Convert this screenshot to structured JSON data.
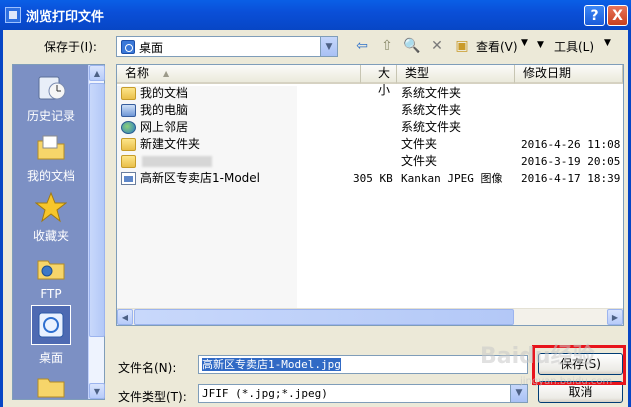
{
  "window": {
    "title": "浏览打印文件",
    "help_label": "?",
    "close_label": "X"
  },
  "toolbar": {
    "save_in_label": "保存于(I):",
    "location_value": "桌面",
    "view_label": "查看(V)",
    "tools_label": "工具(L)"
  },
  "places": [
    {
      "label": "历史记录",
      "icon": "history-icon"
    },
    {
      "label": "我的文档",
      "icon": "my-documents-icon"
    },
    {
      "label": "收藏夹",
      "icon": "favorites-icon"
    },
    {
      "label": "FTP",
      "icon": "ftp-icon"
    },
    {
      "label": "桌面",
      "icon": "desktop-icon",
      "selected": true
    }
  ],
  "columns": {
    "name": "名称",
    "size": "大小",
    "type": "类型",
    "modified": "修改日期"
  },
  "files": [
    {
      "name": "我的文档",
      "size": "",
      "type": "系统文件夹",
      "modified": "",
      "icon": "documents-folder-icon"
    },
    {
      "name": "我的电脑",
      "size": "",
      "type": "系统文件夹",
      "modified": "",
      "icon": "computer-icon"
    },
    {
      "name": "网上邻居",
      "size": "",
      "type": "系统文件夹",
      "modified": "",
      "icon": "network-icon"
    },
    {
      "name": "新建文件夹",
      "size": "",
      "type": "文件夹",
      "modified": "2016-4-26 11:08",
      "icon": "folder-icon"
    },
    {
      "name": "",
      "size": "",
      "type": "文件夹",
      "modified": "2016-3-19 20:05",
      "icon": "folder-icon",
      "blurred": true
    },
    {
      "name": "高新区专卖店1-Model",
      "size": "305 KB",
      "type": "Kankan JPEG 图像",
      "modified": "2016-4-17 18:39",
      "icon": "jpeg-file-icon"
    }
  ],
  "form": {
    "filename_label": "文件名(N):",
    "filename_value": "高新区专卖店1-Model.jpg",
    "filetype_label": "文件类型(T):",
    "filetype_value": "JFIF (*.jpg;*.jpeg)",
    "save_button": "保存(S)",
    "cancel_button": "取消"
  },
  "watermark": {
    "text": "Baidu经验",
    "sub": "jingyan.baidu.com"
  },
  "colors": {
    "titlebar": "#0A4FD8",
    "places_bg": "#7C90C4",
    "selection": "#316AC5",
    "highlight_box": "#E8141C"
  }
}
